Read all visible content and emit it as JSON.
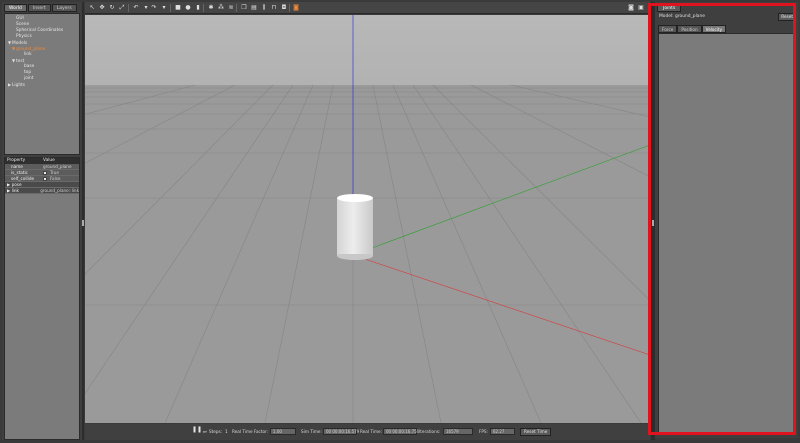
{
  "left_tabs": [
    "World",
    "Insert",
    "Layers"
  ],
  "tree": [
    {
      "label": "GUI",
      "indent": 1,
      "arrow": ""
    },
    {
      "label": "Scene",
      "indent": 1,
      "arrow": ""
    },
    {
      "label": "Spherical Coordinates",
      "indent": 1,
      "arrow": ""
    },
    {
      "label": "Physics",
      "indent": 1,
      "arrow": ""
    },
    {
      "label": "Models",
      "indent": 0,
      "arrow": "▼"
    },
    {
      "label": "ground_plane",
      "indent": 1,
      "arrow": "▼",
      "selected": true
    },
    {
      "label": "link",
      "indent": 3,
      "arrow": ""
    },
    {
      "label": "test",
      "indent": 1,
      "arrow": "▼"
    },
    {
      "label": "base",
      "indent": 3,
      "arrow": ""
    },
    {
      "label": "top",
      "indent": 3,
      "arrow": ""
    },
    {
      "label": "joint",
      "indent": 3,
      "arrow": ""
    },
    {
      "label": "Lights",
      "indent": 0,
      "arrow": "▶"
    }
  ],
  "properties": {
    "header": {
      "property": "Property",
      "value": "Value"
    },
    "rows": [
      {
        "name": "name",
        "value": "ground_plane",
        "type": "text"
      },
      {
        "name": "is_static",
        "value": "True",
        "type": "check"
      },
      {
        "name": "self_collide",
        "value": "False",
        "type": "check"
      },
      {
        "name": "pose",
        "value": "",
        "type": "group"
      },
      {
        "name": "link",
        "value": "ground_plane::link",
        "type": "group"
      }
    ]
  },
  "bottom_bar": {
    "steps_label": "Steps:",
    "steps_value": "1",
    "rtf_label": "Real Time Factor:",
    "rtf_value": "1.00",
    "sim_time_label": "Sim Time:",
    "sim_time_value": "00 00:00:16.579",
    "real_time_label": "Real Time:",
    "real_time_value": "00 00:00:16.750",
    "iterations_label": "Iterations:",
    "iterations_value": "16579",
    "fps_label": "FPS:",
    "fps_value": "62.27",
    "reset_time": "Reset Time"
  },
  "right_panel": {
    "tab": "Joints",
    "model_label": "Model: ground_plane",
    "reset_label": "Reset",
    "joint_tabs": [
      "Force",
      "Position",
      "Velocity"
    ],
    "active_joint_tab": "Velocity"
  },
  "colors": {
    "highlight": "#e0141e",
    "selected_text": "#f28a3a",
    "viewport_bg": "#999999"
  }
}
